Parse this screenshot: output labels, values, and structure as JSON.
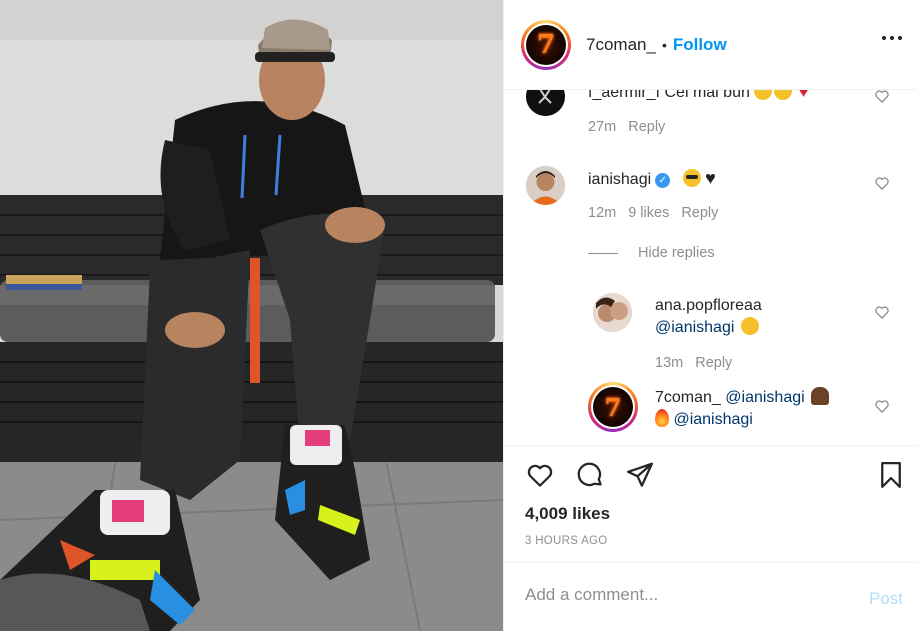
{
  "post": {
    "username": "7coman_",
    "separator": "•",
    "follow_label": "Follow",
    "avatar_glyph": "7",
    "likes_count": "4,009 likes",
    "timestamp": "3 HOURS AGO"
  },
  "comments": [
    {
      "username": "f_aermir_f",
      "text": "Cel mai bun",
      "time": "27m",
      "reply_label": "Reply"
    },
    {
      "username": "ianishagi",
      "verified": true,
      "verified_glyph": "✓",
      "time": "12m",
      "likes": "9 likes",
      "reply_label": "Reply"
    }
  ],
  "hide_replies_label": "Hide replies",
  "replies": [
    {
      "username": "ana.popfloreaa",
      "mention": "@ianishagi",
      "time": "13m",
      "reply_label": "Reply"
    },
    {
      "username": "7coman_",
      "mention1": "@ianishagi",
      "mention2": "@ianishagi",
      "avatar_glyph": "7"
    }
  ],
  "add_comment": {
    "placeholder": "Add a comment...",
    "post_label": "Post"
  },
  "colors": {
    "follow_blue": "#0095f6",
    "post_disabled": "#b2dffc",
    "meta_gray": "#8e8e8e",
    "verified_blue": "#3897f0"
  },
  "icons": [
    "heart-icon",
    "comment-icon",
    "share-icon",
    "bookmark-icon",
    "more-icon",
    "small-heart-icon",
    "verified-icon"
  ]
}
